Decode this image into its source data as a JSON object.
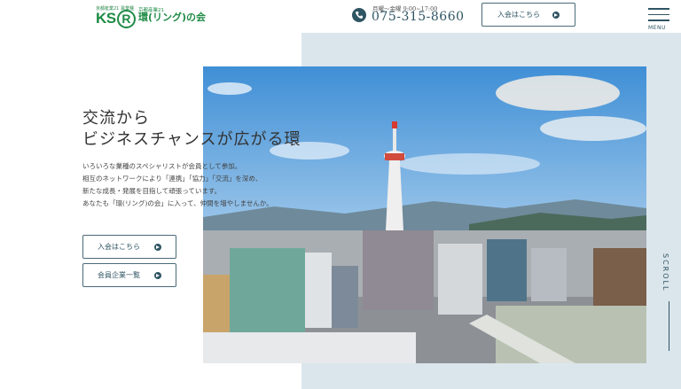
{
  "header": {
    "logo_small": "京都産業21 異業種",
    "logo_ksr": "KS",
    "logo_r": "R",
    "logo_org": "京都産業21",
    "logo_name": "環(リング)の会",
    "hours": "月曜～金曜 9:00~17:00",
    "phone": "075-315-8660",
    "join_button": "入会はこちら",
    "menu_label": "MENU"
  },
  "hero": {
    "catch_line1": "交流から",
    "catch_line2": "ビジネスチャンスが広がる環",
    "lead": [
      "いろいろな業種のスペシャリストが会員として参加。",
      "相互のネットワークにより「連携」「協力」「交流」を深め、",
      "新たな成長・発展を目指して頑張っています。",
      "あなたも「環(リング)の会」に入って、仲間を増やしませんか。"
    ],
    "join_button": "入会はこちら",
    "members_button": "会員企業一覧",
    "scroll": "SCROLL"
  },
  "colors": {
    "accent": "#2f5463",
    "brand_green": "#1d8b45",
    "panel": "#dbe6ec"
  }
}
